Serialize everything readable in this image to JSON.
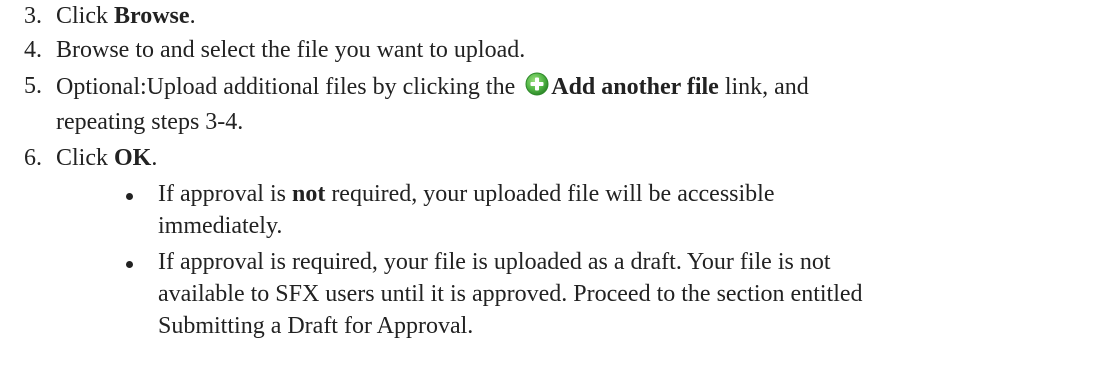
{
  "steps": [
    {
      "number": "3.",
      "prefix": "Click ",
      "bold": "Browse",
      "suffix": "."
    },
    {
      "number": "4.",
      "text": "Browse to and select the file you want to upload."
    },
    {
      "number": "5.",
      "prefix": "Optional:Upload additional files by clicking the ",
      "icon": "add-circle-icon",
      "bold": "Add another file",
      "suffix": " link, and",
      "continuation": "repeating steps 3-4."
    },
    {
      "number": "6.",
      "prefix": "Click ",
      "bold": "OK",
      "suffix": "."
    }
  ],
  "bullets": [
    {
      "prefix": "If approval is ",
      "bold": "not",
      "suffix": " required, your uploaded file will be accessible",
      "continuation": "immediately."
    },
    {
      "line1": "If approval is required, your file is uploaded as a draft. Your file is not",
      "line2": "available to SFX users until it is approved. Proceed to the section entitled",
      "line3": "Submitting a Draft for Approval."
    }
  ],
  "colors": {
    "text": "#222222",
    "icon_green": "#55b848",
    "icon_green_dark": "#2e8a2a"
  }
}
